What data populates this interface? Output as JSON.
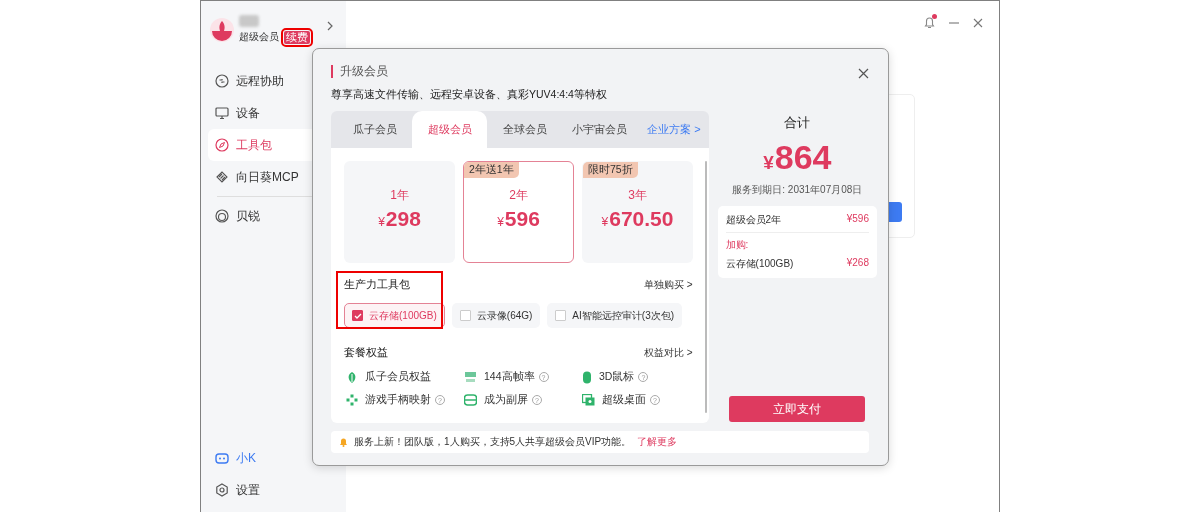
{
  "sidebar": {
    "membership": "超级会员",
    "renew_badge": {
      "label": "续费",
      "highlighted": true
    },
    "items": [
      {
        "label": "远程协助",
        "selected": false
      },
      {
        "label": "设备",
        "selected": false
      },
      {
        "label": "工具包",
        "selected": true
      },
      {
        "label": "向日葵MCP",
        "selected": false
      },
      {
        "label": "贝锐",
        "selected": false
      }
    ],
    "bottom_items": [
      {
        "label": "小K",
        "kind": "assistant"
      },
      {
        "label": "设置",
        "kind": "settings"
      }
    ]
  },
  "titlebar": {
    "notification_dot": true
  },
  "dialog": {
    "title": "升级会员",
    "subtitle": "尊享高速文件传输、远程安卓设备、真彩YUV4:4:4等特权",
    "tabs": [
      {
        "label": "瓜子会员",
        "selected": false
      },
      {
        "label": "超级会员",
        "selected": true
      },
      {
        "label": "全球会员",
        "selected": false
      },
      {
        "label": "小宇宙会员",
        "selected": false
      }
    ],
    "tabs_link": "企业方案 >",
    "plans": [
      {
        "duration": "1年",
        "currency": "¥",
        "price": "298",
        "selected": false
      },
      {
        "badge": "2年送1年",
        "duration": "2年",
        "currency": "¥",
        "price": "596",
        "selected": true
      },
      {
        "badge": "限时75折",
        "duration": "3年",
        "currency": "¥",
        "price": "670.50",
        "selected": false
      }
    ],
    "addons": {
      "title": "生产力工具包",
      "link": "单独购买 >",
      "highlighted": true,
      "items": [
        {
          "label": "云存储(100GB)",
          "checked": true
        },
        {
          "label": "云录像(64G)",
          "checked": false
        },
        {
          "label": "AI智能远控审计(3次包)",
          "checked": false
        }
      ]
    },
    "benefits": {
      "title": "套餐权益",
      "link": "权益对比 >",
      "items": [
        {
          "label": "瓜子会员权益"
        },
        {
          "label": "144高帧率",
          "help": "?"
        },
        {
          "label": "3D鼠标",
          "help": "?"
        },
        {
          "label": "游戏手柄映射",
          "help": "?"
        },
        {
          "label": "成为副屏",
          "help": "?"
        },
        {
          "label": "超级桌面",
          "help": "?"
        }
      ]
    },
    "notice": {
      "text": "服务上新！团队版，1人购买，支持5人共享超级会员VIP功能。",
      "link": "了解更多"
    },
    "summary": {
      "title": "合计",
      "currency": "¥",
      "total": "864",
      "expiry": "服务到期日: 2031年07月08日",
      "lines": [
        {
          "label": "超级会员2年",
          "price": "¥596"
        },
        {
          "label": "云存储(100GB)",
          "price": "¥268"
        }
      ],
      "addon_label": "加购:",
      "pay_button": "立即支付"
    }
  }
}
